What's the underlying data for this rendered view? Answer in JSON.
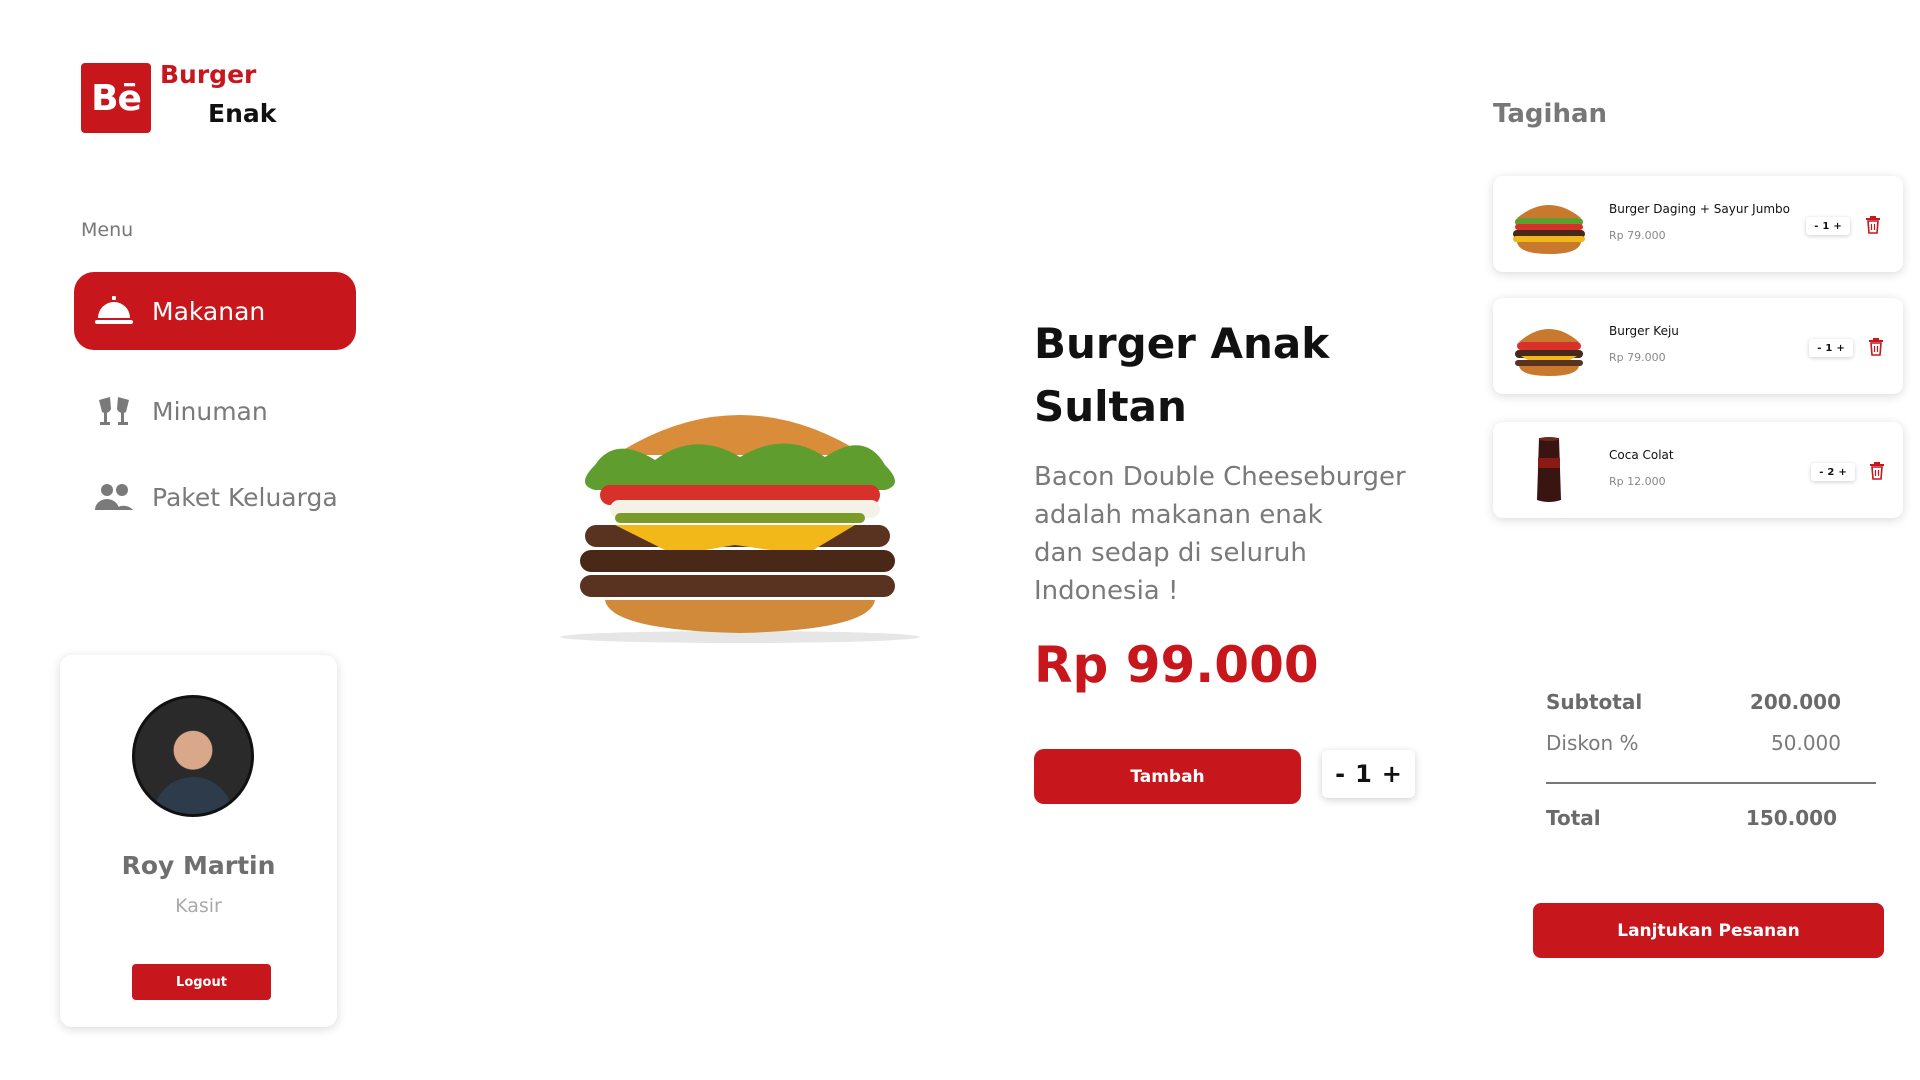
{
  "brand": {
    "logo_mark": "Bē",
    "word1": "Burger",
    "word2": "Enak",
    "accent": "#c8161d"
  },
  "sidebar": {
    "menu_label": "Menu",
    "items": [
      {
        "label": "Makanan",
        "icon": "cloche-icon",
        "active": true
      },
      {
        "label": "Minuman",
        "icon": "cheers-icon",
        "active": false
      },
      {
        "label": "Paket Keluarga",
        "icon": "users-icon",
        "active": false
      }
    ]
  },
  "profile": {
    "name": "Roy Martin",
    "role": "Kasir",
    "logout_label": "Logout"
  },
  "product": {
    "title_line1": "Burger Anak",
    "title_line2": "Sultan",
    "desc_lines": [
      "Bacon Double Cheeseburger",
      "adalah makanan enak",
      "dan sedap di seluruh",
      "Indonesia !"
    ],
    "price": "Rp 99.000",
    "add_label": "Tambah",
    "qty": {
      "minus": "-",
      "value": "1",
      "plus": "+"
    }
  },
  "bill": {
    "title": "Tagihan",
    "items": [
      {
        "name": "Burger Daging + Sayur Jumbo",
        "price": "Rp 79.000",
        "qty": "1"
      },
      {
        "name": "Burger Keju",
        "price": "Rp 79.000",
        "qty": "1"
      },
      {
        "name": "Coca Colat",
        "price": "Rp 12.000",
        "qty": "2"
      }
    ],
    "minus": "-",
    "plus": "+",
    "subtotal_label": "Subtotal",
    "subtotal_value": "200.000",
    "discount_label": "Diskon %",
    "discount_value": "50.000",
    "total_label": "Total",
    "total_value": "150.000",
    "continue_label": "Lanjtukan Pesanan"
  }
}
